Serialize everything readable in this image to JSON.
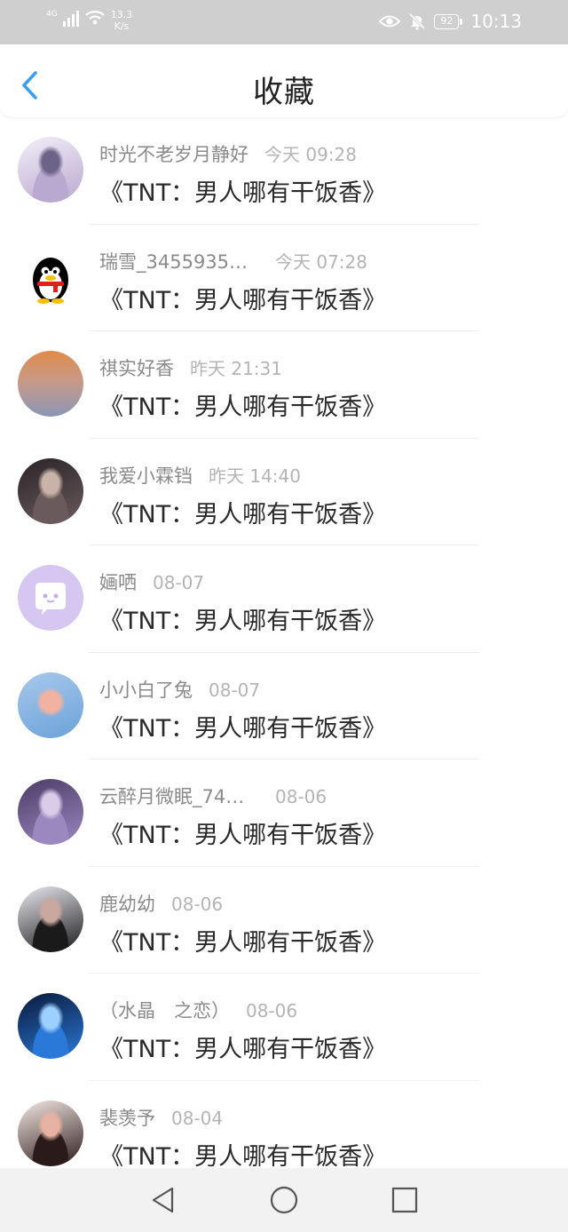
{
  "status_bar": {
    "network_type": "4G",
    "speed_value": "13.3",
    "speed_unit": "K/s",
    "battery": "92",
    "time": "10:13",
    "icons": [
      "signal-icon",
      "wifi-icon",
      "eye-icon",
      "mute-bell-icon",
      "battery-icon"
    ]
  },
  "header": {
    "back_icon": "back-arrow-icon",
    "title": "收藏",
    "accent": "#3aa0f0"
  },
  "items": [
    {
      "name": "时光不老岁月静好",
      "time": "今天 09:28",
      "message": "《TNT：男人哪有干饭香》",
      "avatar": "anime-character-avatar",
      "colors": [
        "#f2eef8",
        "#b9a8cf",
        "#6c6488"
      ]
    },
    {
      "name": "瑞雪_3455935…",
      "time": "今天 07:28",
      "message": "《TNT：男人哪有干饭香》",
      "avatar": "qq-penguin-avatar",
      "colors": [
        "#ffffff",
        "#000000",
        "#f6c000"
      ]
    },
    {
      "name": "祺实好香",
      "time": "昨天 21:31",
      "message": "《TNT：男人哪有干饭香》",
      "avatar": "sunset-sea-avatar",
      "colors": [
        "#e08a4a",
        "#c89a86",
        "#8a96b8"
      ]
    },
    {
      "name": "我爱小霖铛",
      "time": "昨天 14:40",
      "message": "《TNT：男人哪有干饭香》",
      "avatar": "portrait-avatar",
      "colors": [
        "#2a2428",
        "#6b5a5c",
        "#c9b2a8"
      ]
    },
    {
      "name": "婳哂",
      "time": "08-07",
      "message": "《TNT：男人哪有干饭香》",
      "avatar": "chat-bubble-avatar",
      "colors": [
        "#d6c6f2",
        "#c2acec",
        "#ffffff"
      ]
    },
    {
      "name": "小小白了兔",
      "time": "08-07",
      "message": "《TNT：男人哪有干饭香》",
      "avatar": "rose-avatar",
      "colors": [
        "#a8c8ec",
        "#f2b2a2",
        "#6aa2d8"
      ]
    },
    {
      "name": "云醉月微眠_74…",
      "time": "08-06",
      "message": "《TNT：男人哪有干饭香》",
      "avatar": "purple-portrait-avatar",
      "colors": [
        "#4c3c68",
        "#9a88be",
        "#d8cce8"
      ]
    },
    {
      "name": "鹿幼幼",
      "time": "08-06",
      "message": "《TNT：男人哪有干饭香》",
      "avatar": "portrait-avatar",
      "colors": [
        "#e8e8f0",
        "#1a1a1a",
        "#caa8a0"
      ]
    },
    {
      "name": "（水晶　之恋）",
      "time": "08-06",
      "message": "《TNT：男人哪有干饭香》",
      "avatar": "blue-night-avatar",
      "colors": [
        "#0a1a3a",
        "#2a78d8",
        "#9cd0ff"
      ]
    },
    {
      "name": "裴羡予",
      "time": "08-04",
      "message": "《TNT：男人哪有干饭香》",
      "avatar": "portrait-avatar",
      "colors": [
        "#f4e8e4",
        "#2a1a1a",
        "#e8b2a2"
      ]
    }
  ],
  "nav": {
    "back_icon": "triangle-back-icon",
    "home_icon": "circle-home-icon",
    "recent_icon": "square-recent-icon"
  }
}
